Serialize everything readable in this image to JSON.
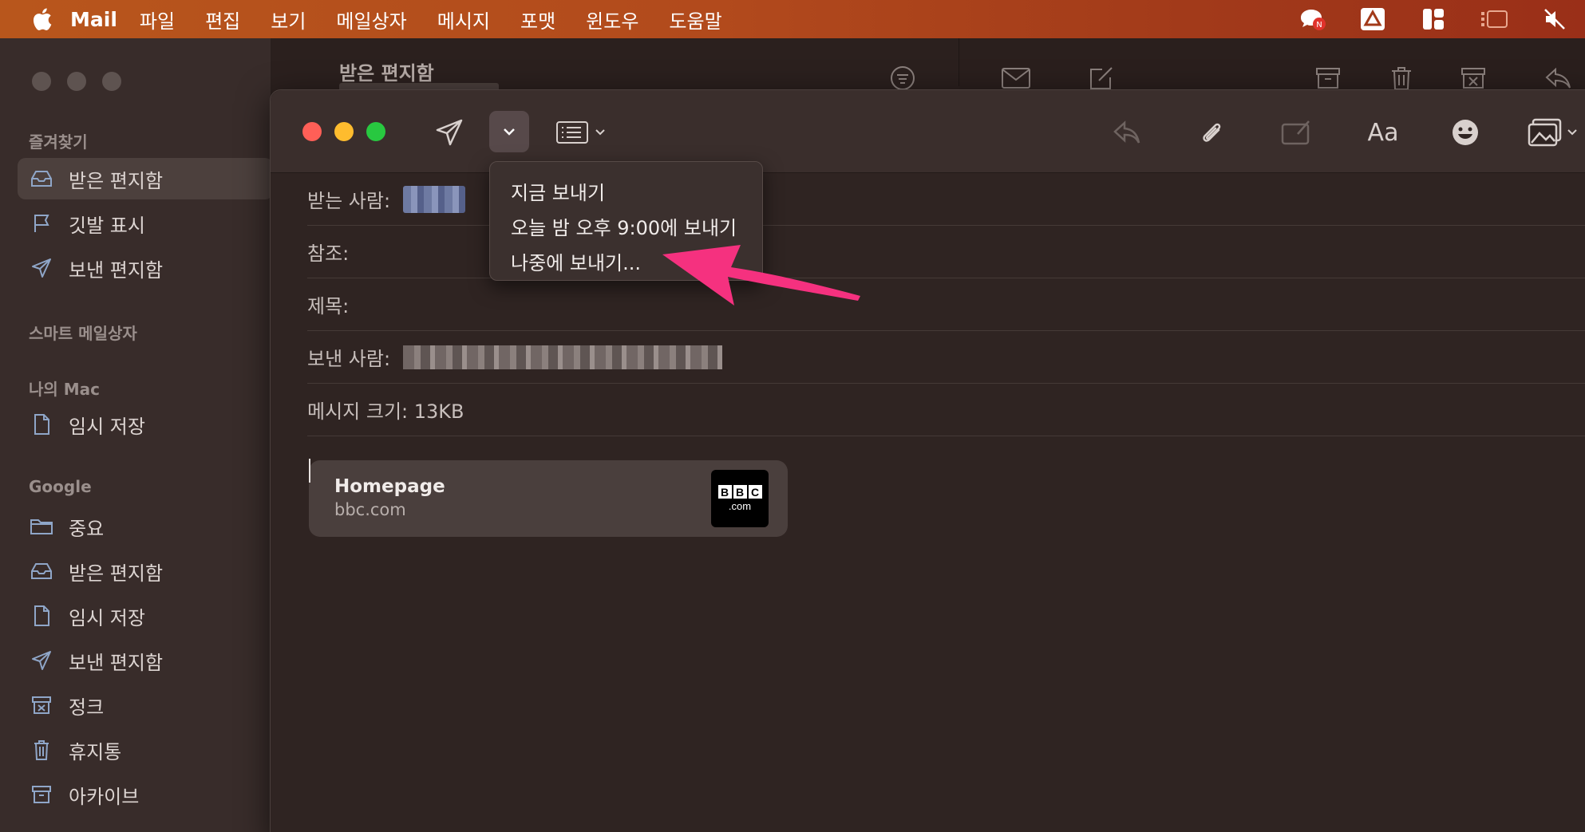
{
  "menubar": {
    "app_name": "Mail",
    "items": [
      "파일",
      "편집",
      "보기",
      "메일상자",
      "메시지",
      "포맷",
      "윈도우",
      "도움말"
    ],
    "status_icons": [
      "messenger-notification-icon",
      "drive-icon",
      "layout-icon",
      "stage-manager-icon",
      "mute-icon"
    ]
  },
  "sidebar": {
    "favorites_header": "즐겨찾기",
    "favorites": [
      {
        "label": "받은 편지함",
        "icon": "inbox-icon"
      },
      {
        "label": "깃발 표시",
        "icon": "flag-icon"
      },
      {
        "label": "보낸 편지함",
        "icon": "sent-icon"
      }
    ],
    "smart_header": "스마트 메일상자",
    "mac_header": "나의 Mac",
    "mac_items": [
      {
        "label": "임시 저장",
        "icon": "draft-icon"
      }
    ],
    "google_header": "Google",
    "google_items": [
      {
        "label": "중요",
        "icon": "folder-icon"
      },
      {
        "label": "받은 편지함",
        "icon": "inbox-icon"
      },
      {
        "label": "임시 저장",
        "icon": "draft-icon"
      },
      {
        "label": "보낸 편지함",
        "icon": "sent-icon"
      },
      {
        "label": "정크",
        "icon": "junk-icon"
      },
      {
        "label": "휴지통",
        "icon": "trash-icon"
      },
      {
        "label": "아카이브",
        "icon": "archive-icon"
      }
    ]
  },
  "listpane": {
    "title": "받은 편지함"
  },
  "compose": {
    "fields": {
      "to_label": "받는 사람:",
      "cc_label": "참조:",
      "subject_label": "제목:",
      "from_label": "보낸 사람:",
      "size_label": "메시지 크기: 13KB"
    },
    "format_label": "Aa",
    "link_card": {
      "title": "Homepage",
      "domain": "bbc.com",
      "logo_letters": [
        "B",
        "B",
        "C"
      ],
      "logo_sub": ".com"
    }
  },
  "send_menu": {
    "items": [
      "지금 보내기",
      "오늘 밤 오후 9:00에 보내기",
      "나중에 보내기..."
    ]
  },
  "colors": {
    "menubar": "#b24a1c",
    "annotation_arrow": "#f5317f",
    "traffic_red": "#ff5f57",
    "traffic_yellow": "#febc2e",
    "traffic_green": "#28c840"
  }
}
